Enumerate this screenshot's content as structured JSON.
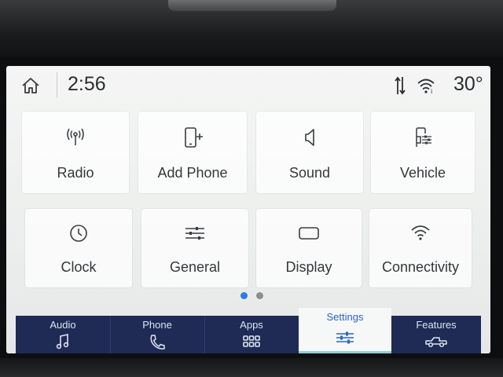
{
  "status": {
    "time": "2:56",
    "temperature": "30°"
  },
  "grid": {
    "row1": [
      {
        "label": "Radio",
        "icon": "radio-antenna-icon"
      },
      {
        "label": "Add Phone",
        "icon": "add-phone-icon"
      },
      {
        "label": "Sound",
        "icon": "speaker-icon"
      },
      {
        "label": "Vehicle",
        "icon": "vehicle-settings-icon"
      }
    ],
    "row2": [
      {
        "label": "Clock",
        "icon": "clock-icon"
      },
      {
        "label": "General",
        "icon": "sliders-icon"
      },
      {
        "label": "Display",
        "icon": "display-icon"
      },
      {
        "label": "Connectivity",
        "icon": "wifi-icon"
      }
    ]
  },
  "pagination": {
    "pages": 2,
    "current": 1
  },
  "nav": {
    "items": [
      {
        "label": "Audio",
        "icon": "music-note-icon"
      },
      {
        "label": "Phone",
        "icon": "phone-icon"
      },
      {
        "label": "Apps",
        "icon": "apps-grid-icon"
      },
      {
        "label": "Settings",
        "icon": "settings-sliders-icon"
      },
      {
        "label": "Features",
        "icon": "truck-icon"
      }
    ],
    "active": "Settings"
  },
  "colors": {
    "screen_bg": "#eceeed",
    "nav_bg": "#1f2a55",
    "accent": "#2f63c6",
    "dot_active": "#2e7de0",
    "dot_inactive": "#8a8d91",
    "underline": "#8fd0d2"
  }
}
